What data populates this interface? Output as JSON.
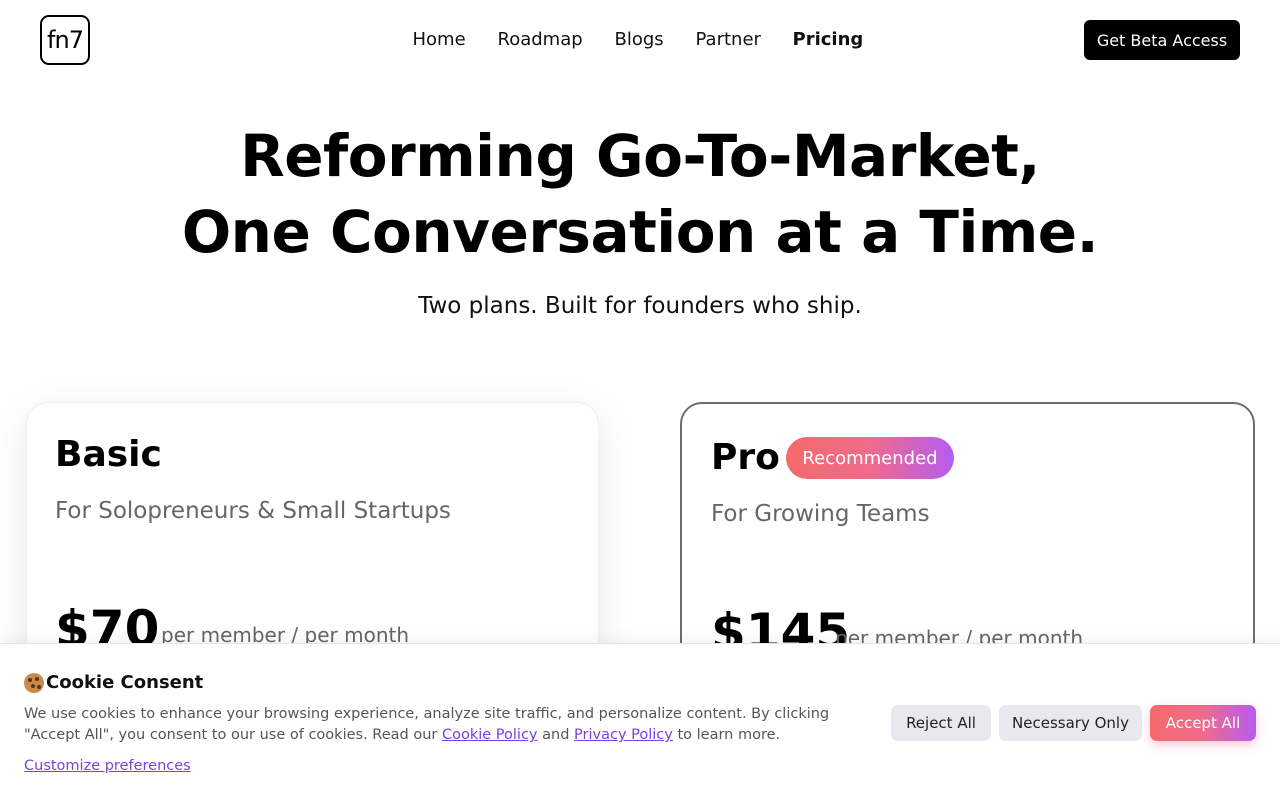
{
  "header": {
    "logo_text": "fn7",
    "nav": [
      "Home",
      "Roadmap",
      "Blogs",
      "Partner",
      "Pricing"
    ],
    "active_nav": "Pricing",
    "cta_label": "Get Beta Access"
  },
  "hero": {
    "title_line1": "Reforming Go-To-Market,",
    "title_line2": "One Conversation at a Time.",
    "subtitle": "Two plans. Built for founders who ship."
  },
  "plans": [
    {
      "name": "Basic",
      "tagline": "For Solopreneurs & Small Startups",
      "price": "$70",
      "unit": "per member / per month"
    },
    {
      "name": "Pro",
      "badge": "Recommended",
      "tagline": "For Growing Teams",
      "price": "$145",
      "unit": "per member / per month"
    }
  ],
  "cookie": {
    "title": "Cookie Consent",
    "text_before": "We use cookies to enhance your browsing experience, analyze site traffic, and personalize content. By clicking \"Accept All\", you consent to our use of cookies. Read our ",
    "cookie_policy_link": "Cookie Policy",
    "and": " and ",
    "privacy_policy_link": "Privacy Policy",
    "text_after": " to learn more.",
    "customize_link": "Customize preferences",
    "reject_label": "Reject All",
    "necessary_label": "Necessary Only",
    "accept_label": "Accept All"
  },
  "colors": {
    "accent_gradient_start": "#f36b6b",
    "accent_gradient_end": "#b65cf0",
    "link": "#7b3fe4"
  }
}
